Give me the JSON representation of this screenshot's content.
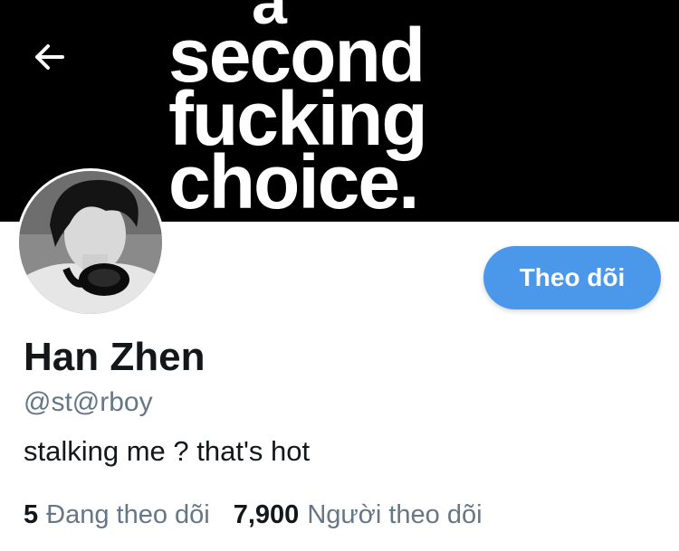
{
  "banner": {
    "lines": [
      "a",
      "second",
      "fucking",
      "choice."
    ]
  },
  "header": {
    "back_icon": "arrow-left-icon"
  },
  "profile": {
    "name": "Han Zhen",
    "handle": "@st@rboy",
    "bio": "stalking me ? that's hot",
    "follow_label": "Theo dõi"
  },
  "stats": {
    "following_count": "5",
    "following_label": "Đang theo dõi",
    "followers_count": "7,900",
    "followers_label": "Người theo dõi"
  },
  "colors": {
    "accent": "#4b98ea",
    "secondary_text": "#657786",
    "primary_text": "#14171a",
    "banner_bg": "#000000"
  }
}
